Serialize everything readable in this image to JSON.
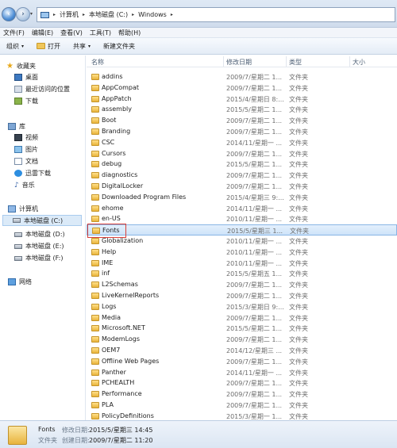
{
  "address": {
    "crumbs": [
      "计算机",
      "本地磁盘 (C:)",
      "Windows"
    ],
    "sep": "▸",
    "nav_drop": "▾"
  },
  "menu": [
    "文件(F)",
    "编辑(E)",
    "查看(V)",
    "工具(T)",
    "帮助(H)"
  ],
  "toolbar": {
    "organize": "组织",
    "open": "打开",
    "share": "共享",
    "new_folder": "新建文件夹",
    "dropdown_glyph": "▾"
  },
  "nav": {
    "favorites_label": "收藏夹",
    "favorites": [
      "桌面",
      "最近访问的位置",
      "下载"
    ],
    "library_label": "库",
    "library": [
      "视频",
      "图片",
      "文档",
      "迅雷下载",
      "音乐"
    ],
    "computer_label": "计算机",
    "drives": [
      "本地磁盘 (C:)",
      "本地磁盘 (D:)",
      "本地磁盘 (E:)",
      "本地磁盘 (F:)"
    ],
    "network_label": "网络"
  },
  "columns": {
    "name": "名称",
    "date": "修改日期",
    "type": "类型",
    "size": "大小",
    "sort_glyph": "^"
  },
  "files": [
    {
      "name": "addins",
      "date": "2009/7/星期二 1...",
      "type": "文件夹"
    },
    {
      "name": "AppCompat",
      "date": "2009/7/星期二 1...",
      "type": "文件夹"
    },
    {
      "name": "AppPatch",
      "date": "2015/4/星期日 8:...",
      "type": "文件夹"
    },
    {
      "name": "assembly",
      "date": "2015/5/星期二 1...",
      "type": "文件夹"
    },
    {
      "name": "Boot",
      "date": "2009/7/星期二 1...",
      "type": "文件夹"
    },
    {
      "name": "Branding",
      "date": "2009/7/星期二 1...",
      "type": "文件夹"
    },
    {
      "name": "CSC",
      "date": "2014/11/星期一 ...",
      "type": "文件夹"
    },
    {
      "name": "Cursors",
      "date": "2009/7/星期二 1...",
      "type": "文件夹"
    },
    {
      "name": "debug",
      "date": "2015/5/星期二 1...",
      "type": "文件夹"
    },
    {
      "name": "diagnostics",
      "date": "2009/7/星期二 1...",
      "type": "文件夹"
    },
    {
      "name": "DigitalLocker",
      "date": "2009/7/星期二 1...",
      "type": "文件夹"
    },
    {
      "name": "Downloaded Program Files",
      "date": "2015/4/星期三 9:...",
      "type": "文件夹"
    },
    {
      "name": "ehome",
      "date": "2014/11/星期一 ...",
      "type": "文件夹"
    },
    {
      "name": "en-US",
      "date": "2010/11/星期一 ...",
      "type": "文件夹"
    },
    {
      "name": "Fonts",
      "date": "2015/5/星期三 1...",
      "type": "文件夹",
      "selected": true
    },
    {
      "name": "Globalization",
      "date": "2010/11/星期一 ...",
      "type": "文件夹"
    },
    {
      "name": "Help",
      "date": "2010/11/星期一 ...",
      "type": "文件夹"
    },
    {
      "name": "IME",
      "date": "2010/11/星期一 ...",
      "type": "文件夹"
    },
    {
      "name": "inf",
      "date": "2015/5/星期五 1...",
      "type": "文件夹"
    },
    {
      "name": "L2Schemas",
      "date": "2009/7/星期二 1...",
      "type": "文件夹"
    },
    {
      "name": "LiveKernelReports",
      "date": "2009/7/星期二 1...",
      "type": "文件夹"
    },
    {
      "name": "Logs",
      "date": "2015/3/星期日 9:...",
      "type": "文件夹"
    },
    {
      "name": "Media",
      "date": "2009/7/星期二 1...",
      "type": "文件夹"
    },
    {
      "name": "Microsoft.NET",
      "date": "2015/5/星期二 1...",
      "type": "文件夹"
    },
    {
      "name": "ModemLogs",
      "date": "2009/7/星期二 1...",
      "type": "文件夹"
    },
    {
      "name": "OEM7",
      "date": "2014/12/星期三 ...",
      "type": "文件夹"
    },
    {
      "name": "Offline Web Pages",
      "date": "2009/7/星期二 1...",
      "type": "文件夹"
    },
    {
      "name": "Panther",
      "date": "2014/11/星期一 ...",
      "type": "文件夹"
    },
    {
      "name": "PCHEALTH",
      "date": "2009/7/星期二 1...",
      "type": "文件夹"
    },
    {
      "name": "Performance",
      "date": "2009/7/星期二 1...",
      "type": "文件夹"
    },
    {
      "name": "PLA",
      "date": "2009/7/星期二 1...",
      "type": "文件夹"
    },
    {
      "name": "PolicyDefinitions",
      "date": "2015/3/星期一 1...",
      "type": "文件夹"
    }
  ],
  "status": {
    "name": "Fonts",
    "modified_label": "修改日期:",
    "modified": "2015/5/星期三 14:45",
    "type": "文件夹",
    "created_label": "创建日期:",
    "created": "2009/7/星期二 11:20"
  }
}
